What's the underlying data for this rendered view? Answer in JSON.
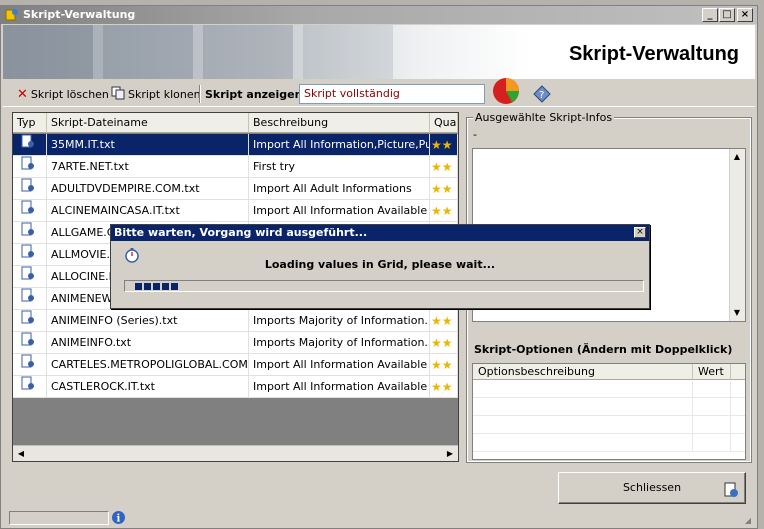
{
  "window": {
    "title": "Skript-Verwaltung",
    "heading": "Skript-Verwaltung",
    "controls": [
      "_",
      "□",
      "×"
    ]
  },
  "toolbar": {
    "delete_label": "Skript löschen",
    "clone_label": "Skript klonen",
    "show_label": "Skript anzeigen",
    "mode_value": "Skript vollständig"
  },
  "grid": {
    "columns": [
      "Typ",
      "Skript-Dateiname",
      "Beschreibung",
      "Qua"
    ],
    "rows": [
      {
        "name": "35MM.IT.txt",
        "desc": "Import All Information,Picture,Pu...",
        "selected": true
      },
      {
        "name": "7ARTE.NET.txt",
        "desc": "First try",
        "selected": false
      },
      {
        "name": "ADULTDVDEMPIRE.COM.txt",
        "desc": "Import All Adult Informations",
        "selected": false
      },
      {
        "name": "ALCINEMAINCASA.IT.txt",
        "desc": "Import All Information Available a...",
        "selected": false
      },
      {
        "name": "ALLGAME.CO",
        "desc": "",
        "selected": false
      },
      {
        "name": "ALLMOVIE.C",
        "desc": "",
        "selected": false
      },
      {
        "name": "ALLOCINE.F",
        "desc": "",
        "selected": false
      },
      {
        "name": "ANIMENEWS",
        "desc": "",
        "selected": false
      },
      {
        "name": "ANIMEINFO (Series).txt",
        "desc": "Imports Majority of Information. ...",
        "selected": false
      },
      {
        "name": "ANIMEINFO.txt",
        "desc": "Imports Majority of Information. ...",
        "selected": false
      },
      {
        "name": "CARTELES.METROPOLIGLOBAL.COM.txt",
        "desc": "Import All Information Available : ...",
        "selected": false
      },
      {
        "name": "CASTLEROCK.IT.txt",
        "desc": "Import All Information Available a...",
        "selected": false
      }
    ],
    "quality_stars": "★★"
  },
  "info": {
    "group_title": "Ausgewählte Skript-Infos",
    "dash": "-",
    "options_title": "Skript-Optionen (Ändern mit Doppelklick)",
    "options_columns": [
      "Optionsbeschreibung",
      "Wert"
    ]
  },
  "close_button": {
    "label": "Schliessen"
  },
  "dialog": {
    "title": "Bitte warten, Vorgang wird ausgeführt...",
    "message": "Loading values in Grid, please wait...",
    "progress_blocks": 5
  },
  "colors": {
    "selection": "#0a246a",
    "window_bg": "#d4d0c8",
    "mode_text": "#8b0000"
  }
}
